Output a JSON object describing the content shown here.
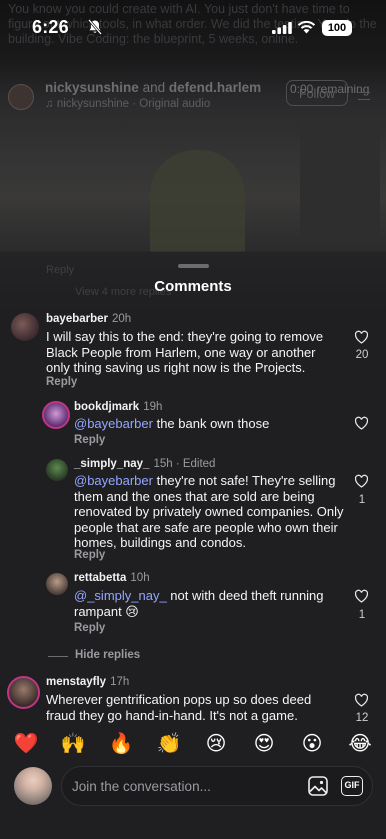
{
  "status_bar": {
    "time": "6:26",
    "battery": "100"
  },
  "background": {
    "caption": "You know you could create with AI. You just don't have time to figure out which tools, in what order. We did the testing. You do the building. Vibe Coding: the blueprint, 5 weeks, online."
  },
  "reel": {
    "author": "nickysunshine",
    "conjunction": "and",
    "collaborator": "defend.harlem",
    "audio": "nickysunshine · Original audio",
    "remaining": "0:00 remaining",
    "follow_label": "Follow"
  },
  "sheet": {
    "ghost_username": "Reply",
    "ghost_view_more": "View 4 more replies",
    "title": "Comments"
  },
  "comments": [
    {
      "username": "bayebarber",
      "age": "20h",
      "text": "I will say this to the end: they're going to remove Black People from Harlem, one way or another only thing saving us right now is the Projects.",
      "reply_label": "Reply",
      "likes": "20"
    },
    {
      "username": "bookdjmark",
      "age": "19h",
      "mention": "@bayebarber",
      "text": " the bank own those",
      "reply_label": "Reply"
    },
    {
      "username": "_simply_nay_",
      "age": "15h · Edited",
      "mention": "@bayebarber",
      "text": " they're not safe! They're selling them and the ones that are sold are being renovated by privately owned companies. Only people that are safe are people who own their homes, buildings and condos.",
      "reply_label": "Reply",
      "likes": "1"
    },
    {
      "username": "rettabetta",
      "age": "10h",
      "mention": "@_simply_nay_",
      "text": "  not with deed theft running rampant 😢",
      "reply_label": "Reply",
      "likes": "1"
    },
    {
      "username": "menstayfly",
      "age": "17h",
      "text": "Wherever gentrification pops up so does deed fraud they go hand-in-hand. It's not a game.",
      "likes": "12"
    }
  ],
  "hide_replies_label": "Hide replies",
  "emoji_bar": [
    "❤️",
    "🙌",
    "🔥",
    "👏",
    "😢",
    "😍",
    "😮",
    "😂"
  ],
  "composer": {
    "placeholder": "Join the conversation...",
    "gif_label": "GIF"
  },
  "colors": {
    "mention": "#94a6ff",
    "sheet_bg": "#1f1f21",
    "story_ring": "#c13584"
  },
  "icons": [
    "bell-slash-icon",
    "signal-icon",
    "wifi-icon",
    "battery-icon",
    "music-note-icon",
    "menu-icon",
    "heart-icon",
    "image-icon",
    "gif-icon"
  ]
}
